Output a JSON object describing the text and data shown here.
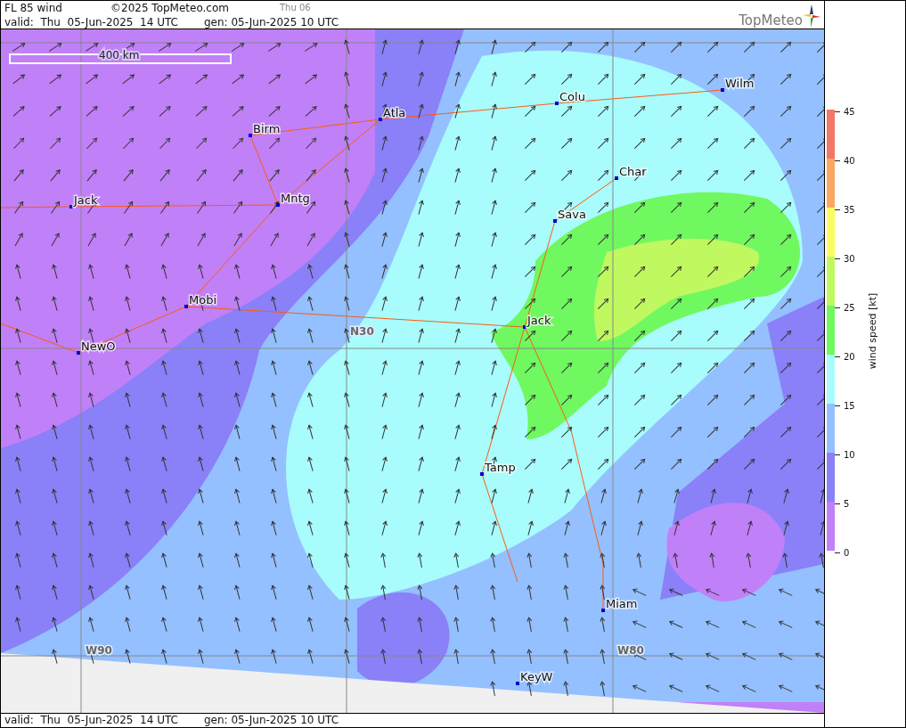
{
  "header": {
    "title": "FL 85 wind",
    "copyright": "©2025 TopMeteo.com",
    "next_day": "Thu 06",
    "valid": "valid:  Thu  05-Jun-2025  14 UTC",
    "generated": "gen: 05-Jun-2025 10 UTC",
    "logo": "TopMeteo"
  },
  "map": {
    "scale": "400 km",
    "grid_labels": [
      "N30",
      "W90",
      "W80"
    ],
    "cities": [
      "Wilm",
      "Colu",
      "Atla",
      "Birm",
      "Char",
      "Jack",
      "Mntg",
      "Sava",
      "Mobi",
      "Jack",
      "NewO",
      "Tamp",
      "Miam",
      "KeyW"
    ]
  },
  "legend": {
    "title": "wind speed [kt]",
    "ticks": [
      "45",
      "40",
      "35",
      "30",
      "25",
      "20",
      "15",
      "10",
      "5",
      "0"
    ],
    "bands": [
      {
        "color": "#f07868"
      },
      {
        "color": "#f8a860"
      },
      {
        "color": "#fcfc60"
      },
      {
        "color": "#c0f860"
      },
      {
        "color": "#70f860"
      },
      {
        "color": "#a8fcfc"
      },
      {
        "color": "#94c0ff"
      },
      {
        "color": "#8a80f8"
      },
      {
        "color": "#c080f8"
      }
    ]
  },
  "footer": {
    "valid": "valid:  Thu  05-Jun-2025  14 UTC",
    "generated": "gen: 05-Jun-2025 10 UTC"
  }
}
